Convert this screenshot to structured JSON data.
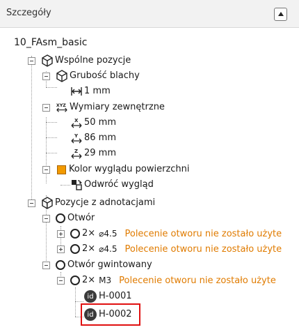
{
  "panel": {
    "title": "Szczegóły"
  },
  "tree": {
    "root": "10_FAsm_basic",
    "common": {
      "label": "Wspólne pozycje",
      "thickness": {
        "label": "Grubość blachy",
        "value": "1 mm"
      },
      "dimensions": {
        "label": "Wymiary zewnętrzne",
        "x": "50 mm",
        "y": "86 mm",
        "z": "29 mm"
      },
      "color": {
        "label": "Kolor wyglądu powierzchni",
        "flip": "Odwróć wygląd",
        "swatch": "#f29a00"
      }
    },
    "annotated": {
      "label": "Pozycje z adnotacjami",
      "hole": {
        "label": "Otwór",
        "items": [
          {
            "count": "2×",
            "size": "⌀4.5",
            "warning": "Polecenie otworu nie zostało użyte"
          },
          {
            "count": "2×",
            "size": "⌀4.5",
            "warning": "Polecenie otworu nie zostało użyte"
          }
        ]
      },
      "thread": {
        "label": "Otwór gwintowany",
        "item": {
          "count": "2×",
          "size": "M3",
          "warning": "Polecenie otworu nie zostało użyte"
        },
        "ids": [
          "H-0001",
          "H-0002"
        ]
      }
    },
    "id_badge": "id",
    "axis": {
      "x": "X",
      "y": "Y",
      "z": "Z",
      "xyz": "XYZ"
    }
  },
  "colors": {
    "warning": "#e07b00",
    "highlight": "#e01010"
  }
}
